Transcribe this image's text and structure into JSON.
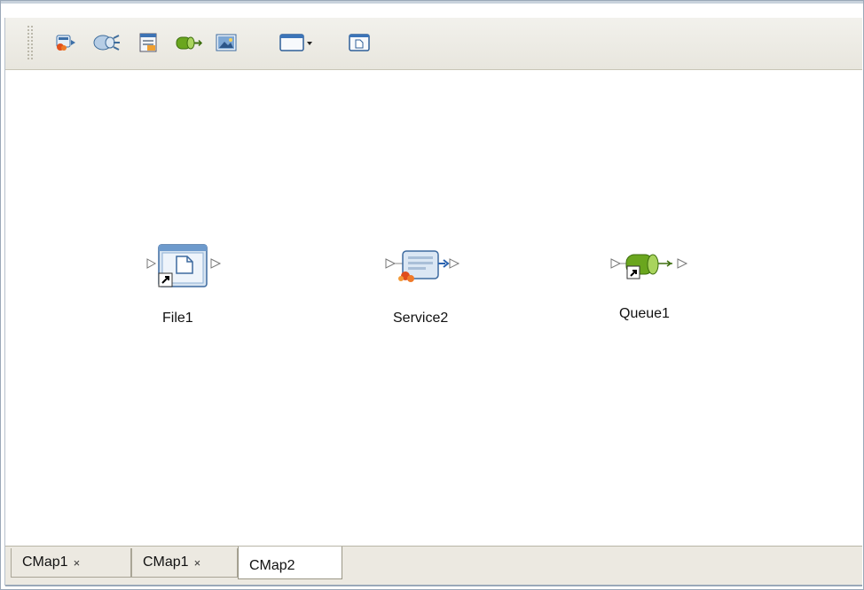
{
  "toolbar": {
    "buttons": [
      {
        "icon": "file-external-icon"
      },
      {
        "icon": "service-engine-icon"
      },
      {
        "icon": "properties-sheet-icon"
      },
      {
        "icon": "queue-add-icon"
      },
      {
        "icon": "image-picture-icon"
      },
      {
        "icon": "window-layout-dropdown-icon"
      },
      {
        "icon": "document-window-icon"
      }
    ]
  },
  "canvas": {
    "nodes": [
      {
        "label": "File1",
        "icon": "file-node-icon"
      },
      {
        "label": "Service2",
        "icon": "service-node-icon"
      },
      {
        "label": "Queue1",
        "icon": "queue-node-icon"
      }
    ]
  },
  "tabs": [
    {
      "label": "CMap1",
      "close": "×",
      "active": false
    },
    {
      "label": "CMap1",
      "close": "×",
      "active": false
    },
    {
      "label": "CMap2",
      "close": "",
      "active": true
    }
  ]
}
